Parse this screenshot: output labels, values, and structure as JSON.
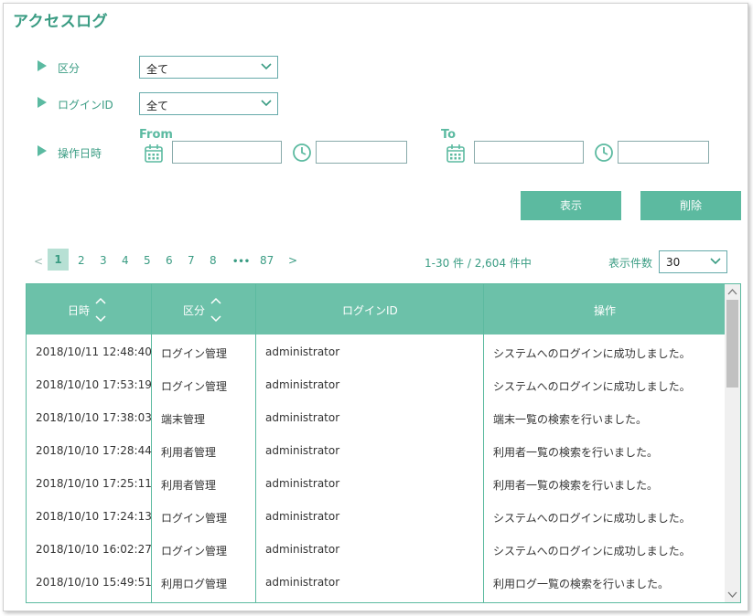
{
  "page": {
    "title": "アクセスログ"
  },
  "filters": {
    "category": {
      "label": "区分",
      "value": "全て"
    },
    "login_id": {
      "label": "ログインID",
      "value": "全て"
    },
    "date": {
      "label": "操作日時",
      "from": "From",
      "to": "To"
    }
  },
  "buttons": {
    "show": "表示",
    "delete": "削除"
  },
  "pagination": {
    "prev": "<",
    "next": ">",
    "ellipsis": "•••",
    "pages": [
      "1",
      "2",
      "3",
      "4",
      "5",
      "6",
      "7",
      "8"
    ],
    "last": "87",
    "summary": "1-30 件 / 2,604 件中",
    "per_page_label": "表示件数",
    "per_page_value": "30"
  },
  "table": {
    "headers": [
      "日時",
      "区分",
      "ログインID",
      "操作"
    ],
    "rows": [
      [
        "2018/10/11 12:48:40",
        "ログイン管理",
        "administrator",
        "システムへのログインに成功しました。"
      ],
      [
        "2018/10/10 17:53:19",
        "ログイン管理",
        "administrator",
        "システムへのログインに成功しました。"
      ],
      [
        "2018/10/10 17:38:03",
        "端末管理",
        "administrator",
        "端末一覧の検索を行いました。"
      ],
      [
        "2018/10/10 17:28:44",
        "利用者管理",
        "administrator",
        "利用者一覧の検索を行いました。"
      ],
      [
        "2018/10/10 17:25:11",
        "利用者管理",
        "administrator",
        "利用者一覧の検索を行いました。"
      ],
      [
        "2018/10/10 17:24:13",
        "ログイン管理",
        "administrator",
        "システムへのログインに成功しました。"
      ],
      [
        "2018/10/10 16:02:27",
        "ログイン管理",
        "administrator",
        "システムへのログインに成功しました。"
      ],
      [
        "2018/10/10 15:49:51",
        "利用ログ管理",
        "administrator",
        "利用ログ一覧の検索を行いました。"
      ]
    ]
  },
  "colors": {
    "accent": "#5cbaa0",
    "title": "#3a9c83",
    "header": "#6cc1a9"
  }
}
